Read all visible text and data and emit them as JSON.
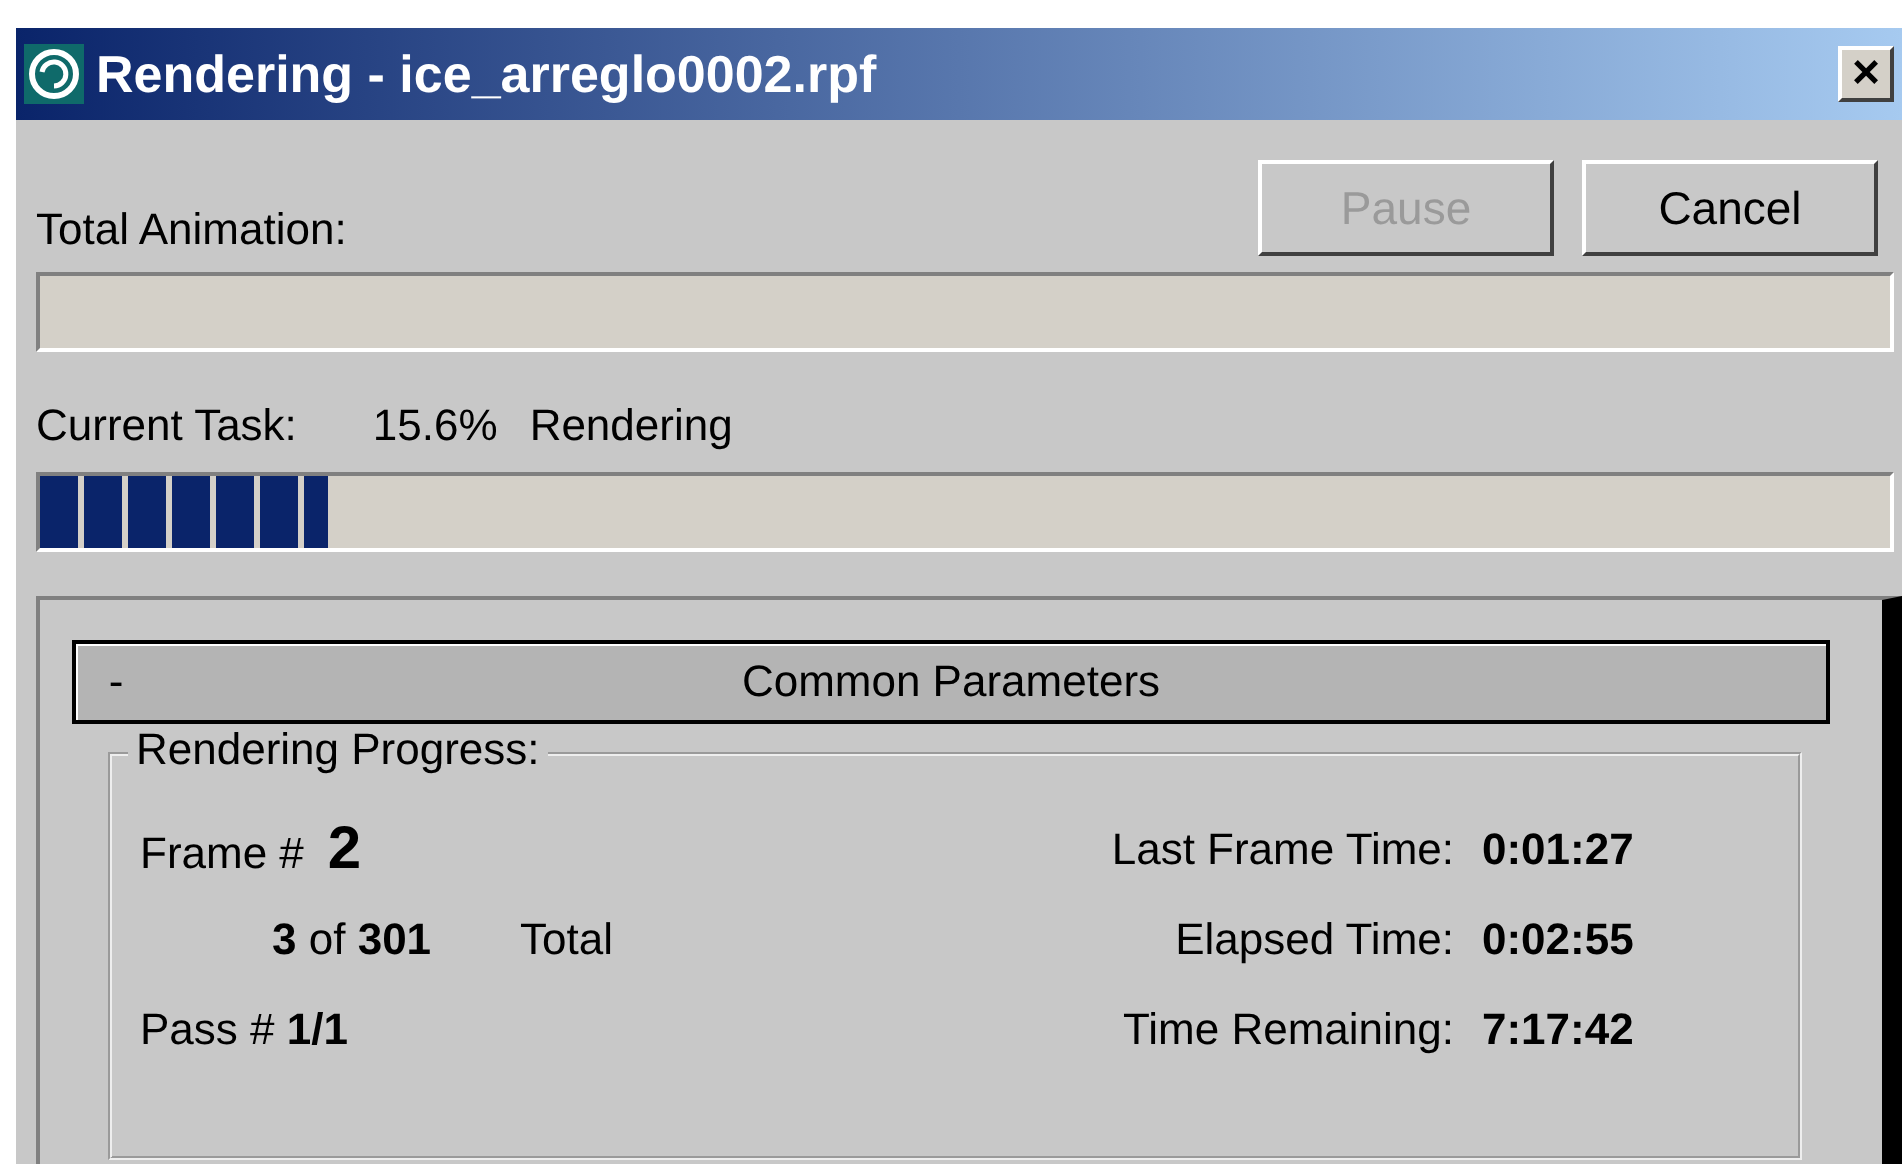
{
  "window": {
    "title": "Rendering - ice_arreglo0002.rpf",
    "close": "×"
  },
  "buttons": [
    {
      "label": "Pause",
      "disabled": true
    },
    {
      "label": "Cancel",
      "disabled": false
    }
  ],
  "total_animation": {
    "label": "Total Animation:"
  },
  "current_task": {
    "label": "Current Task:",
    "percent": "15.6%",
    "status": "Rendering",
    "level": 0.156
  },
  "rollout": {
    "collapse": "-",
    "title": "Common Parameters"
  },
  "progress_group": {
    "title": "Rendering Progress:",
    "frame_label": "Frame #",
    "frame": "2",
    "frame_count": "**3** of **301**",
    "total_label": "Total",
    "pass": "Pass # **1/1**",
    "times": [
      {
        "label": "Last Frame Time:",
        "value": "0:01:27"
      },
      {
        "label": "Elapsed Time:",
        "value": "0:02:55"
      },
      {
        "label": "Time Remaining:",
        "value": "7:17:42"
      }
    ]
  }
}
